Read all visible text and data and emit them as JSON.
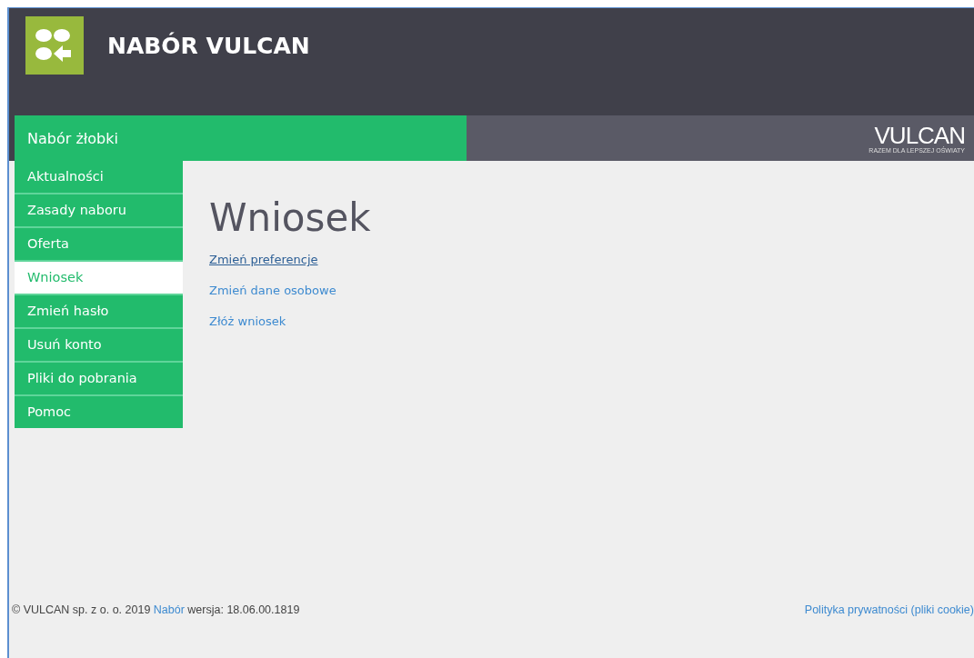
{
  "header": {
    "title": "NABÓR VULCAN"
  },
  "section_bar": {
    "title": "Nabór żłobki"
  },
  "brand": {
    "name": "VULCAN",
    "tagline": "RAZEM DLA LEPSZEJ OŚWIATY"
  },
  "sidebar": {
    "items": [
      {
        "label": "Aktualności",
        "selected": false
      },
      {
        "label": "Zasady naboru",
        "selected": false
      },
      {
        "label": "Oferta",
        "selected": false
      },
      {
        "label": "Wniosek",
        "selected": true
      },
      {
        "label": "Zmień hasło",
        "selected": false
      },
      {
        "label": "Usuń konto",
        "selected": false
      },
      {
        "label": "Pliki do pobrania",
        "selected": false
      },
      {
        "label": "Pomoc",
        "selected": false
      }
    ]
  },
  "content": {
    "heading": "Wniosek",
    "links": [
      {
        "label": "Zmień preferencje",
        "underlined": true
      },
      {
        "label": "Zmień dane osobowe",
        "underlined": false
      },
      {
        "label": "Złóż wniosek",
        "underlined": false
      }
    ]
  },
  "footer": {
    "copyright": "© VULCAN sp. z o. o. 2019",
    "app_link": "Nabór",
    "version": "wersja: 18.06.00.1819",
    "privacy_link": "Polityka prywatności (pliki cookie)"
  }
}
